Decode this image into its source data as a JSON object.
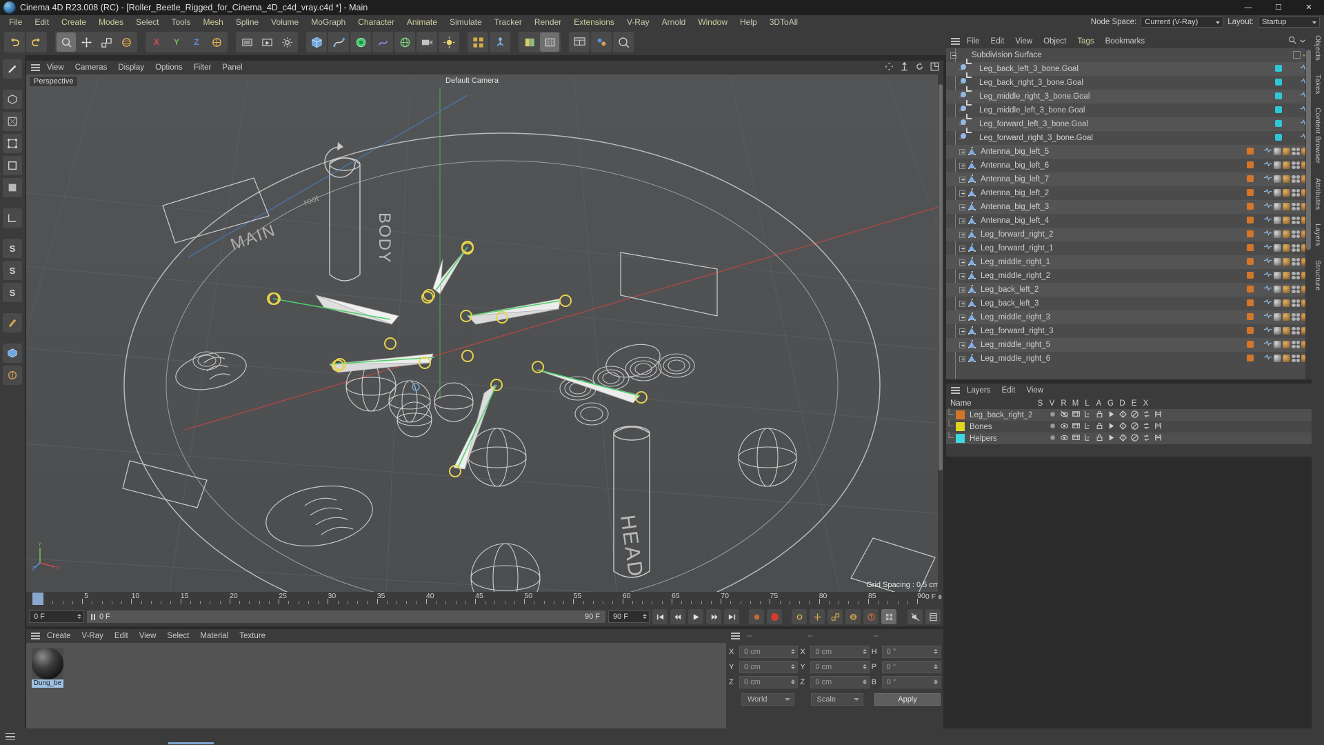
{
  "window": {
    "title": "Cinema 4D R23.008 (RC) - [Roller_Beetle_Rigged_for_Cinema_4D_c4d_vray.c4d *] - Main",
    "minimize": "—",
    "maximize": "☐",
    "close": "✕"
  },
  "menubar": {
    "items": [
      "File",
      "Edit",
      "Create",
      "Modes",
      "Select",
      "Tools",
      "Mesh",
      "Spline",
      "Volume",
      "MoGraph",
      "Character",
      "Animate",
      "Simulate",
      "Tracker",
      "Render",
      "Extensions",
      "V-Ray",
      "Arnold",
      "Window",
      "Help",
      "3DToAll"
    ],
    "node_space_label": "Node Space:",
    "node_space_value": "Current (V-Ray)",
    "layout_label": "Layout:",
    "layout_value": "Startup"
  },
  "viewport": {
    "menu": [
      "View",
      "Cameras",
      "Display",
      "Options",
      "Filter",
      "Panel"
    ],
    "label": "Perspective",
    "camera": "Default Camera",
    "grid_spacing": "Grid Spacing : 0.5 cm",
    "axis_labels": [
      "Y",
      "Z",
      "X"
    ],
    "scene_text": [
      "BODY",
      "MAIN",
      "HEAD"
    ]
  },
  "timeline": {
    "ticks": [
      0,
      5,
      10,
      15,
      20,
      25,
      30,
      35,
      40,
      45,
      50,
      55,
      60,
      65,
      70,
      75,
      80,
      85,
      90
    ],
    "current_frame_display": "0 F",
    "playhead_frame": "0 F",
    "start_field": "0 F",
    "preview_field": "0 F",
    "end_field_a": "90 F",
    "end_field_b": "90 F"
  },
  "transport": {
    "buttons": [
      "go-to-start",
      "step-back",
      "play",
      "step-forward",
      "go-to-end"
    ],
    "record_label": "record",
    "toggles": [
      "autokey",
      "key-position",
      "key-scale",
      "key-rotation",
      "key-param",
      "key-pla",
      "point-level"
    ]
  },
  "materials": {
    "menu": [
      "Create",
      "V-Ray",
      "Edit",
      "View",
      "Select",
      "Material",
      "Texture"
    ],
    "items": [
      {
        "name": "Dung_be",
        "selected": true
      }
    ]
  },
  "coordinates": {
    "header_dashes": [
      "--",
      "--",
      "--"
    ],
    "rows": [
      {
        "pos_label": "X",
        "pos_value": "0 cm",
        "size_label": "X",
        "size_value": "0 cm",
        "rot_label": "H",
        "rot_value": "0 °"
      },
      {
        "pos_label": "Y",
        "pos_value": "0 cm",
        "size_label": "Y",
        "size_value": "0 cm",
        "rot_label": "P",
        "rot_value": "0 °"
      },
      {
        "pos_label": "Z",
        "pos_value": "0 cm",
        "size_label": "Z",
        "size_value": "0 cm",
        "rot_label": "B",
        "rot_value": "0 °"
      }
    ],
    "system": "World",
    "mode": "Scale",
    "apply": "Apply"
  },
  "objects": {
    "menu": [
      "File",
      "Edit",
      "View",
      "Object",
      "Tags",
      "Bookmarks"
    ],
    "rows": [
      {
        "name": "Subdivision Surface",
        "icon": "subdivision-surface-icon",
        "depth": 0,
        "toggle": "minus",
        "tags": []
      },
      {
        "name": "Leg_back_left_3_bone.Goal",
        "icon": "goal-icon",
        "depth": 1,
        "toggle": "none",
        "tags": [
          "cyan",
          "dots"
        ]
      },
      {
        "name": "Leg_back_right_3_bone.Goal",
        "icon": "goal-icon",
        "depth": 1,
        "toggle": "none",
        "tags": [
          "cyan",
          "dots"
        ]
      },
      {
        "name": "Leg_middle_right_3_bone.Goal",
        "icon": "goal-icon",
        "depth": 1,
        "toggle": "none",
        "tags": [
          "cyan",
          "dots"
        ]
      },
      {
        "name": "Leg_middle_left_3_bone.Goal",
        "icon": "goal-icon",
        "depth": 1,
        "toggle": "none",
        "tags": [
          "cyan",
          "dots"
        ]
      },
      {
        "name": "Leg_forward_left_3_bone.Goal",
        "icon": "goal-icon",
        "depth": 1,
        "toggle": "none",
        "tags": [
          "cyan",
          "dots"
        ]
      },
      {
        "name": "Leg_forward_right_3_bone.Goal",
        "icon": "goal-icon",
        "depth": 1,
        "toggle": "none",
        "tags": [
          "cyan",
          "dots"
        ]
      },
      {
        "name": "Antenna_big_left_5",
        "icon": "joint-icon",
        "depth": 1,
        "toggle": "plus",
        "tags": [
          "orange",
          "full"
        ]
      },
      {
        "name": "Antenna_big_left_6",
        "icon": "joint-icon",
        "depth": 1,
        "toggle": "plus",
        "tags": [
          "orange",
          "full"
        ]
      },
      {
        "name": "Antenna_big_left_7",
        "icon": "joint-icon",
        "depth": 1,
        "toggle": "plus",
        "tags": [
          "orange",
          "full"
        ]
      },
      {
        "name": "Antenna_big_left_2",
        "icon": "joint-icon",
        "depth": 1,
        "toggle": "plus",
        "tags": [
          "orange",
          "full"
        ]
      },
      {
        "name": "Antenna_big_left_3",
        "icon": "joint-icon",
        "depth": 1,
        "toggle": "plus",
        "tags": [
          "orange",
          "full"
        ]
      },
      {
        "name": "Antenna_big_left_4",
        "icon": "joint-icon",
        "depth": 1,
        "toggle": "plus",
        "tags": [
          "orange",
          "full"
        ]
      },
      {
        "name": "Leg_forward_right_2",
        "icon": "joint-icon",
        "depth": 1,
        "toggle": "plus",
        "tags": [
          "orange",
          "full"
        ]
      },
      {
        "name": "Leg_forward_right_1",
        "icon": "joint-icon",
        "depth": 1,
        "toggle": "plus",
        "tags": [
          "orange",
          "full"
        ]
      },
      {
        "name": "Leg_middle_right_1",
        "icon": "joint-icon",
        "depth": 1,
        "toggle": "plus",
        "tags": [
          "orange",
          "full"
        ]
      },
      {
        "name": "Leg_middle_right_2",
        "icon": "joint-icon",
        "depth": 1,
        "toggle": "plus",
        "tags": [
          "orange",
          "full"
        ]
      },
      {
        "name": "Leg_back_left_2",
        "icon": "joint-icon",
        "depth": 1,
        "toggle": "plus",
        "tags": [
          "orange",
          "full"
        ]
      },
      {
        "name": "Leg_back_left_3",
        "icon": "joint-icon",
        "depth": 1,
        "toggle": "plus",
        "tags": [
          "orange",
          "full"
        ]
      },
      {
        "name": "Leg_middle_right_3",
        "icon": "joint-icon",
        "depth": 1,
        "toggle": "plus",
        "tags": [
          "orange",
          "full"
        ]
      },
      {
        "name": "Leg_forward_right_3",
        "icon": "joint-icon",
        "depth": 1,
        "toggle": "plus",
        "tags": [
          "orange",
          "full"
        ]
      },
      {
        "name": "Leg_middle_right_5",
        "icon": "joint-icon",
        "depth": 1,
        "toggle": "plus",
        "tags": [
          "orange",
          "full"
        ]
      },
      {
        "name": "Leg_middle_right_6",
        "icon": "joint-icon",
        "depth": 1,
        "toggle": "plus",
        "tags": [
          "orange",
          "full"
        ]
      }
    ]
  },
  "layers": {
    "menu": [
      "Layers",
      "Edit",
      "View"
    ],
    "columns": [
      "Name",
      "S",
      "V",
      "R",
      "M",
      "L",
      "A",
      "G",
      "D",
      "E",
      "X"
    ],
    "rows": [
      {
        "name": "Leg_back_right_2",
        "color": "#d3762a",
        "visible": false
      },
      {
        "name": "Bones",
        "color": "#e0d41e",
        "visible": true
      },
      {
        "name": "Helpers",
        "color": "#3fd8e0",
        "visible": true
      }
    ]
  },
  "right_tabs": [
    "Objects",
    "Takes",
    "Content Browser",
    "Attributes",
    "Layers",
    "Structure"
  ],
  "status": {
    "message": ""
  },
  "colors": {
    "accent_blue": "#8aa8cf",
    "record_red": "#d23b2e",
    "panel_bg": "#3b3b3b",
    "list_bg": "#4b4b4b",
    "viewport_bg": "#4f5153"
  }
}
